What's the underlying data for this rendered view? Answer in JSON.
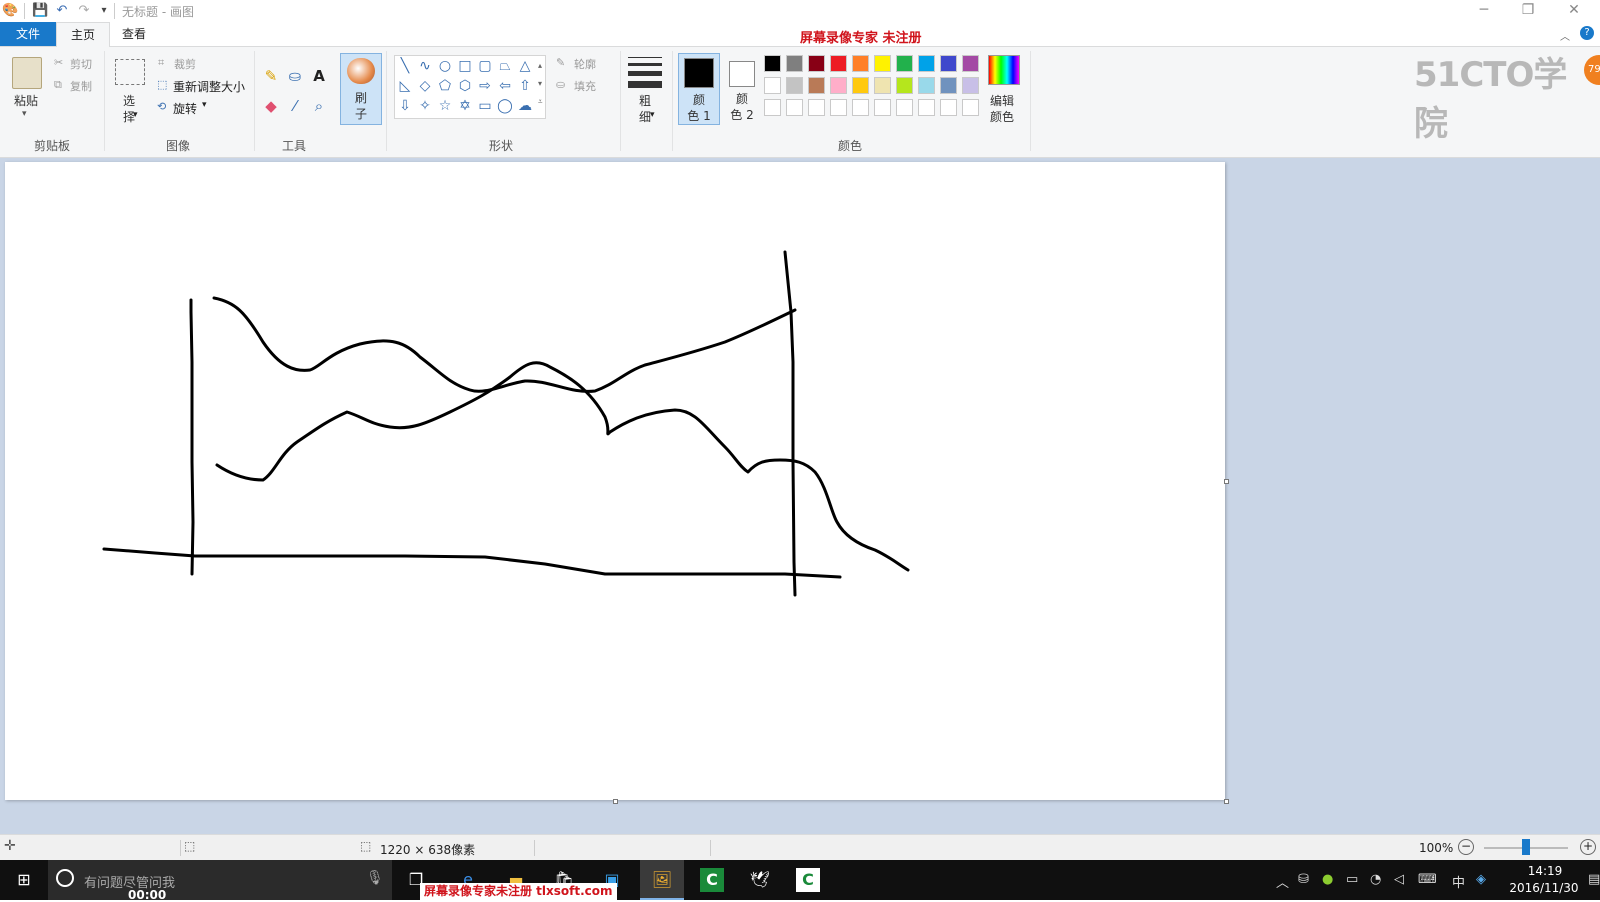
{
  "app": {
    "title": "无标题 - 画图"
  },
  "watermark": {
    "top": "屏幕录像专家  未注册",
    "bottom": "屏幕录像专家未注册 tlxsoft.com",
    "brand_logo": "51CTO学院",
    "badge": "79"
  },
  "tabs": [
    {
      "label": "文件"
    },
    {
      "label": "主页"
    },
    {
      "label": "查看"
    }
  ],
  "ribbon": {
    "clipboard": {
      "label": "剪贴板",
      "paste": "粘贴",
      "cut": "剪切",
      "copy": "复制"
    },
    "image": {
      "label": "图像",
      "select": "选\n择",
      "crop": "裁剪",
      "resize": "重新调整大小",
      "rotate": "旋转"
    },
    "tools": {
      "label": "工具"
    },
    "brushes": {
      "label": "刷\n子"
    },
    "shapes": {
      "label": "形状",
      "outline": "轮廓",
      "fill": "填充"
    },
    "size": {
      "label": "粗\n细"
    },
    "colors": {
      "label": "颜色",
      "color1": "颜\n色 1",
      "color2": "颜\n色 2",
      "edit": "编辑\n颜色",
      "palette_row1": [
        "#000000",
        "#7f7f7f",
        "#880015",
        "#ed1c24",
        "#ff7f27",
        "#fff200",
        "#22b14c",
        "#00a2e8",
        "#3f48cc",
        "#a349a4"
      ],
      "palette_row2": [
        "#ffffff",
        "#c3c3c3",
        "#b97a57",
        "#ffaec9",
        "#ffc90e",
        "#efe4b0",
        "#b5e61d",
        "#99d9ea",
        "#7092be",
        "#c8bfe7"
      ],
      "palette_row3": [
        "#ffffff",
        "#ffffff",
        "#ffffff",
        "#ffffff",
        "#ffffff",
        "#ffffff",
        "#ffffff",
        "#ffffff",
        "#ffffff",
        "#ffffff"
      ]
    }
  },
  "status": {
    "canvas_size": "1220 × 638像素",
    "zoom": "100%"
  },
  "taskbar": {
    "search_placeholder": "有问题尽管问我",
    "timer": "00:00",
    "ime": "中",
    "time": "14:19",
    "date": "2016/11/30"
  }
}
